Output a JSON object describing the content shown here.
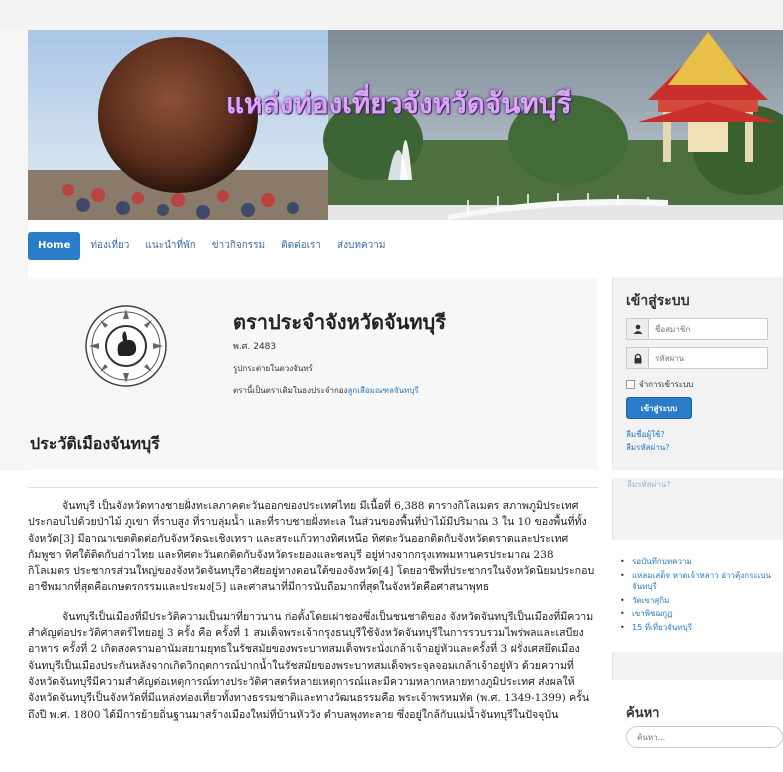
{
  "site": {
    "banner_title": "แหล่งท่องเที่ยวจังหวัดจันทบุรี"
  },
  "nav": {
    "items": [
      {
        "label": "Home",
        "active": true
      },
      {
        "label": "ท่องเที่ยว"
      },
      {
        "label": "แนะนำที่พัก"
      },
      {
        "label": "ข่าวกิจกรรม"
      },
      {
        "label": "ติดต่อเรา"
      },
      {
        "label": "ส่งบทความ"
      }
    ]
  },
  "emblem": {
    "title": "ตราประจำจังหวัดจันทบุรี",
    "year": "พ.ศ. 2483",
    "desc1": "รูปกระต่ายในดวงจันทร์",
    "desc2_prefix": "ตรานี้เป็นตราเดิมในธงประจำกอง",
    "desc2_link": "ลูกเสือมณฑลจันทบุรี"
  },
  "history": {
    "heading": "ประวัติเมืองจันทบุรี",
    "paragraph1": "จันทบุรี เป็นจังหวัดทางชายฝั่งทะเลภาคตะวันออกของประเทศไทย มีเนื้อที่ 6,388 ตารางกิโลเมตร สภาพภูมิประเทศประกอบไปด้วยป่าไม้ ภูเขา ที่ราบสูง ที่ราบลุ่มน้ำ และที่ราบชายฝั่งทะเล ในส่วนของพื้นที่ป่าไม้มีปริมาณ 3 ใน 10 ของพื้นที่ทั้งจังหวัด[3] มีอาณาเขตติดต่อกับจังหวัดฉะเชิงเทรา และสระแก้วทางทิศเหนือ ทิศตะวันออกติดกับจังหวัดตราดและประเทศกัมพูชา ทิศใต้ติดกับอ่าวไทย และทิศตะวันตกติดกับจังหวัดระยองและชลบุรี อยู่ห่างจากกรุงเทพมหานครประมาณ 238 กิโลเมตร ประชากรส่วนใหญ่ของจังหวัดจันทบุรีอาศัยอยู่ทางตอนใต้ของจังหวัด[4] โดยอาชีพที่ประชากรในจังหวัดนิยมประกอบอาชีพมากที่สุดคือเกษตรกรรมและประมง[5] และศาสนาที่มีการนับถือมากที่สุดในจังหวัดคือศาสนาพุทธ",
    "paragraph2": "จันทบุรีเป็นเมืองที่มีประวัติความเป็นมาที่ยาวนาน ก่อตั้งโดยเผ่าชองซึ่งเป็นชนชาติของ จังหวัดจันทบุรีเป็นเมืองที่มีความสำคัญต่อประวัติศาสตร์ไทยอยู่ 3 ครั้ง คือ ครั้งที่ 1 สมเด็จพระเจ้ากรุงธนบุรีใช้จังหวัดจันทบุรีในการรวบรวมไพร่พลและเสบียงอาหาร ครั้งที่ 2 เกิดสงครามอานัมสยามยุทธในรัชสมัยของพระบาทสมเด็จพระนั่งเกล้าเจ้าอยู่หัวและครั้งที่ 3 ฝรั่งเศสยึดเมืองจันทบุรีเป็นเมืองประกันหลังจากเกิดวิกฤตการณ์ปากน้ำในรัชสมัยของพระบาทสมเด็จพระจุลจอมเกล้าเจ้าอยู่หัว ด้วยความที่จังหวัดจันทบุรีมีความสำคัญต่อเหตุการณ์ทางประวัติศาสตร์หลายเหตุการณ์และมีความหลากหลายทางภูมิประเทศ ส่งผลให้จังหวัดจันทบุรีเป็นจังหวัดที่มีแหล่งท่องเที่ยวทั้งทางธรรมชาติและทางวัฒนธรรมคือ พระเจ้าพรหมทัต (พ.ศ. 1349-1399) ครั้นถึงปี พ.ศ. 1800 ได้มีการย้ายถิ่นฐานมาสร้างเมืองใหม่ที่บ้านหัววัง ตำบลพุงทะลาย ซึ่งอยู่ใกล้กับแม่น้ำจันทบุรีในปัจจุบัน"
  },
  "login": {
    "title": "เข้าสู่ระบบ",
    "username_placeholder": "ชื่อสมาชิก",
    "password_placeholder": "รหัสผ่าน",
    "remember_label": "จำการเข้าระบบ",
    "submit_label": "เข้าสู่ระบบ",
    "forgot_username": "ลืมชื่อผู้ใช้?",
    "forgot_password": "ลืมรหัสผ่าน?"
  },
  "side_cut_text": "ลืมรหัสผ่าน?",
  "articles": {
    "items": [
      "รอบันทึกบทความ",
      "แหลมเสด็จ หาดเจ้าหลาว อ่าวคุ้งกระเบน จันทบุรี",
      "วัดเขาสุกิม",
      "เขาพิชฌกูฏ",
      "15 ที่เที่ยวจันทบุรี"
    ]
  },
  "search": {
    "title": "ค้นหา",
    "placeholder": "ค้นหา..."
  },
  "icons": {
    "user": "user-icon",
    "lock": "lock-icon",
    "emblem": "rabbit-moon-seal-icon"
  }
}
